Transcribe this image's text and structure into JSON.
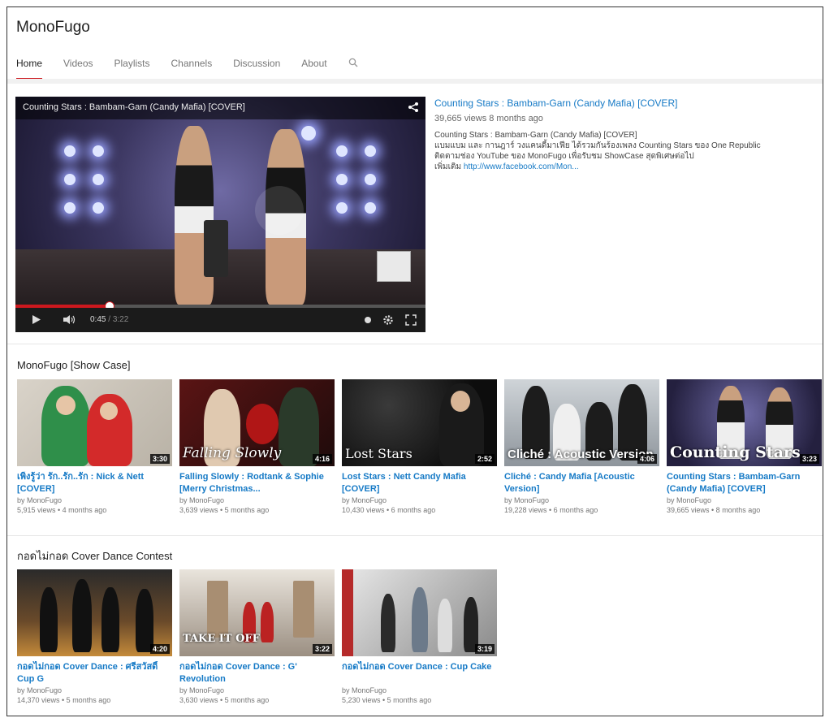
{
  "channel": {
    "name": "MonoFugo"
  },
  "tabs": [
    {
      "label": "Home",
      "active": true
    },
    {
      "label": "Videos"
    },
    {
      "label": "Playlists"
    },
    {
      "label": "Channels"
    },
    {
      "label": "Discussion"
    },
    {
      "label": "About"
    }
  ],
  "player": {
    "title": "Counting Stars : Bambam-Gam (Candy Mafia) [COVER]",
    "current_time": "0:45",
    "total_time": "3:22",
    "progress": 0.23
  },
  "featured": {
    "title": "Counting Stars : Bambam-Garn (Candy Mafia) [COVER]",
    "meta": "39,665 views 8 months ago",
    "desc_line1": "Counting Stars : Bambam-Garn (Candy Mafia) [COVER]",
    "desc_line2": "แบมแบม และ กานฎาร์ วงแคนดี้มาเฟีย ได้รวมกันร้องเพลง Counting Stars ของ One Republic",
    "desc_line3": "ติดตามช่อง YouTube ของ MonoFugo เพื่อรับชม ShowCase สุดพิเศษต่อไป",
    "desc_more": "เพิ่มเติม",
    "desc_link": "http://www.facebook.com/Mon..."
  },
  "sections": [
    {
      "title": "MonoFugo [Show Case]",
      "videos": [
        {
          "title": "เพิ่งรู้ว่า รัก..รัก..รัก : Nick & Nett [COVER]",
          "by": "by MonoFugo",
          "meta": "5,915 views • 4 months ago",
          "duration": "3:30",
          "thumb_text": ""
        },
        {
          "title": "Falling Slowly : Rodtank & Sophie [Merry Christmas...",
          "by": "by MonoFugo",
          "meta": "3,639 views • 5 months ago",
          "duration": "4:16",
          "thumb_text": "Falling Slowly"
        },
        {
          "title": "Lost Stars : Nett Candy Mafia [COVER]",
          "by": "by MonoFugo",
          "meta": "10,430 views • 6 months ago",
          "duration": "2:52",
          "thumb_text": "Lost Stars"
        },
        {
          "title": "Cliché : Candy Mafia [Acoustic Version]",
          "by": "by MonoFugo",
          "meta": "19,228 views • 6 months ago",
          "duration": "4:06",
          "thumb_text": "Cliché : Acoustic Version"
        },
        {
          "title": "Counting Stars : Bambam-Garn (Candy Mafia) [COVER]",
          "by": "by MonoFugo",
          "meta": "39,665 views • 8 months ago",
          "duration": "3:23",
          "thumb_text": "Counting Stars"
        }
      ]
    },
    {
      "title": "กอดไม่กอด Cover Dance Contest",
      "videos": [
        {
          "title": "กอดไม่กอด Cover Dance : ศรีสวัสดิ์ Cup G",
          "by": "by MonoFugo",
          "meta": "14,370 views • 5 months ago",
          "duration": "4:20",
          "thumb_text": ""
        },
        {
          "title": "กอดไม่กอด Cover Dance : G' Revolution",
          "by": "by MonoFugo",
          "meta": "3,630 views • 5 months ago",
          "duration": "3:22",
          "thumb_text": "TAKE IT OFF"
        },
        {
          "title": "กอดไม่กอด Cover Dance : Cup Cake",
          "by": "by MonoFugo",
          "meta": "5,230 views • 5 months ago",
          "duration": "3:19",
          "thumb_text": ""
        }
      ]
    }
  ],
  "colors": {
    "accent": "#cc181e",
    "link": "#167ac6"
  },
  "icons": [
    "search-icon",
    "share-icon",
    "play-icon",
    "volume-icon",
    "settings-icon",
    "fullscreen-icon",
    "annotations-icon"
  ]
}
